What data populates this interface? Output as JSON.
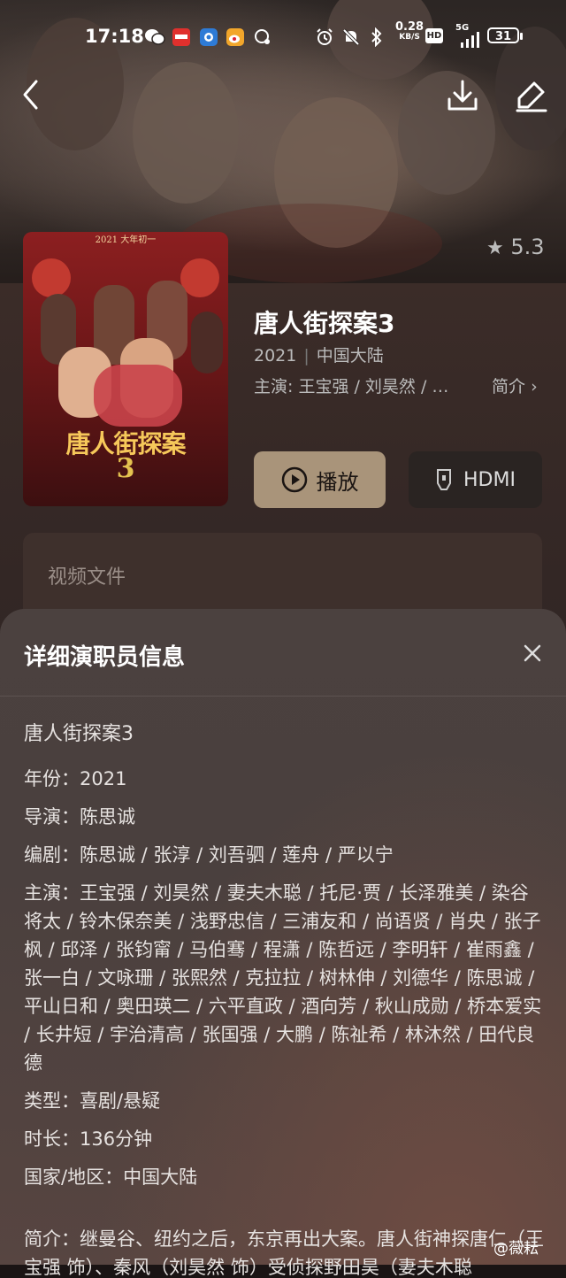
{
  "status_bar": {
    "time": "17:18",
    "net_speed": "0.28",
    "net_unit": "KB/S",
    "hd": "HD",
    "signal": "5G",
    "battery": "31"
  },
  "detail": {
    "rating": "5.3",
    "title": "唐人街探案3",
    "year": "2021",
    "region": "中国大陆",
    "cast_line": "主演: 王宝强 / 刘昊然 / 妻夫木聪 / 托尼·贾",
    "intro_link": "简介",
    "play_label": "播放",
    "hdmi_label": "HDMI",
    "files_label": "视频文件",
    "poster": {
      "top_text": "2021 大年初一",
      "logo_text": "唐人街探案",
      "logo_num": "3"
    }
  },
  "sheet": {
    "title": "详细演职员信息",
    "movie_title": "唐人街探案3",
    "year": "年份：2021",
    "director": "导演：陈思诚",
    "writers": "编剧：陈思诚 / 张淳 / 刘吾驷 / 莲舟 / 严以宁",
    "cast": "主演：王宝强 / 刘昊然 / 妻夫木聪 / 托尼·贾 / 长泽雅美 / 染谷将太 / 铃木保奈美 / 浅野忠信 / 三浦友和 / 尚语贤 / 肖央 / 张子枫 / 邱泽 / 张钧甯 / 马伯骞 / 程潇 / 陈哲远 / 李明轩 / 崔雨鑫 / 张一白 / 文咏珊 / 张熙然 / 克拉拉 / 树林伸 / 刘德华 / 陈思诚 / 平山日和 / 奥田瑛二 / 六平直政 / 酒向芳 / 秋山成勋 / 桥本爱实 / 长井短 / 宇治清高 / 张国强 / 大鹏 / 陈祉希 / 林沐然 / 田代良德",
    "genre": "类型：喜剧/悬疑",
    "duration": "时长：136分钟",
    "country": "国家/地区：中国大陆",
    "synopsis": "简介：继曼谷、纽约之后，东京再出大案。唐人街神探唐仁（王宝强 饰）、秦风（刘昊然 饰）受侦探野田昊（妻夫木聪"
  },
  "watermark": "@薇耘"
}
